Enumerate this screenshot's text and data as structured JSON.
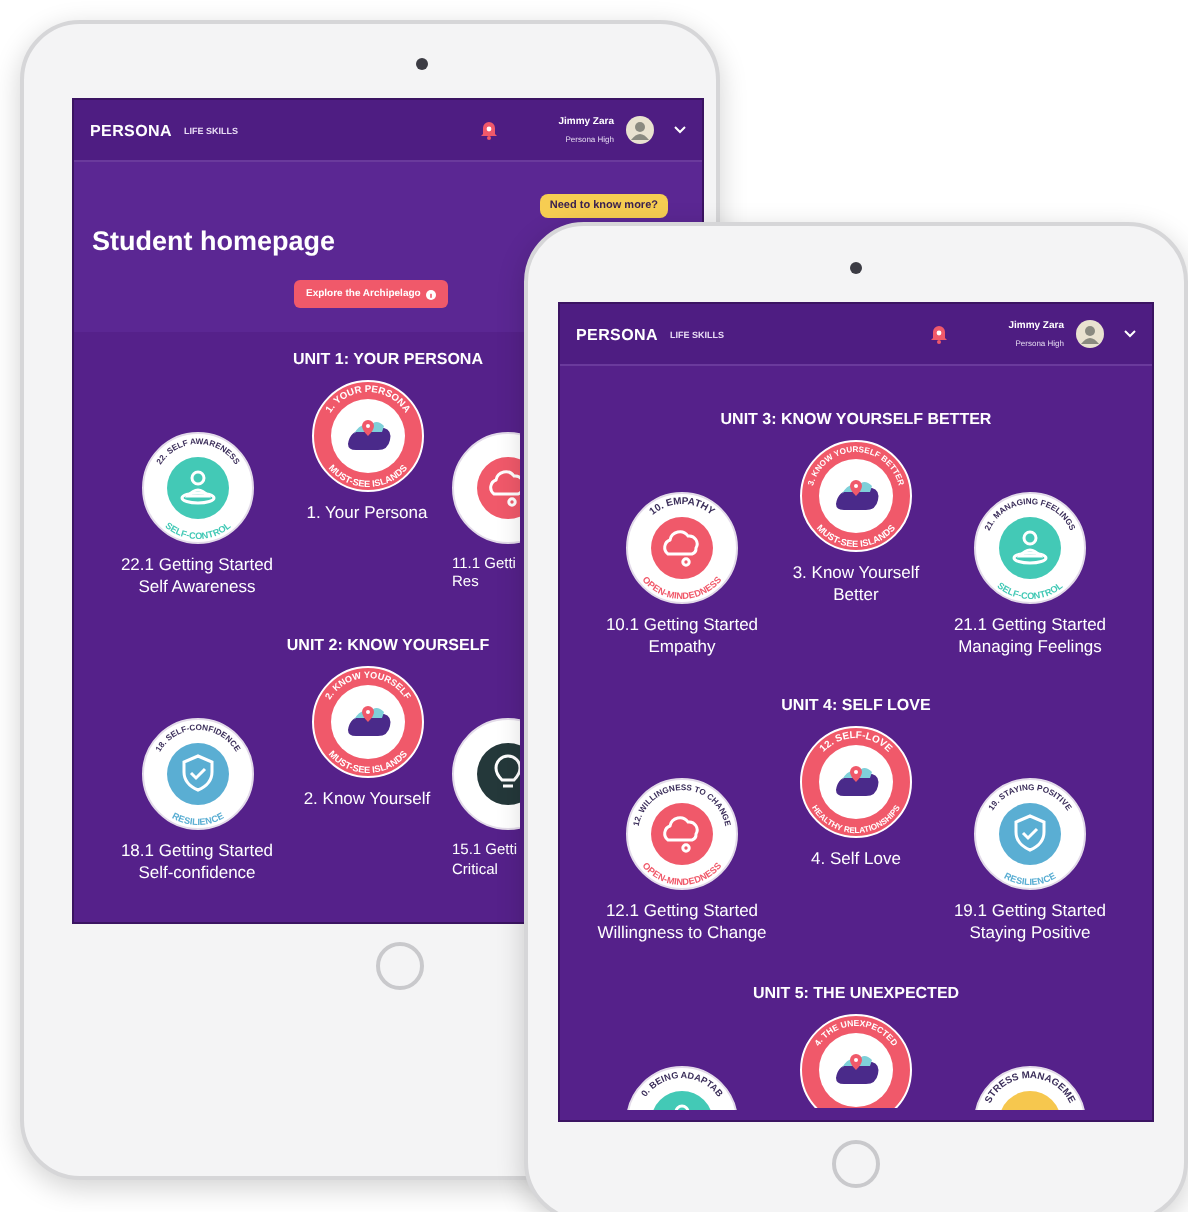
{
  "tablets": [
    {
      "header": {
        "logo": "PERSONA",
        "logo_suffix": "LIFE SKILLS",
        "user_name": "Jimmy Zara",
        "school": "Persona High"
      },
      "hero": {
        "help_button": "Need to know more?",
        "title": "Student homepage",
        "explore_button": "Explore the Archipelago"
      },
      "units": [
        {
          "title": "UNIT 1: YOUR PERSONA",
          "items": [
            {
              "kind": "control",
              "ring_top": "22. SELF AWARENESS",
              "ring_bottom": "SELF-CONTROL",
              "label": [
                "22.1 Getting Started",
                "Self Awareness"
              ]
            },
            {
              "kind": "island",
              "ring_top": "1. YOUR PERSONA",
              "ring_bottom": "MUST-SEE ISLANDS",
              "label": [
                "1. Your Persona"
              ]
            },
            {
              "kind": "open",
              "label": [
                "11.1 Getti",
                "Res"
              ]
            }
          ]
        },
        {
          "title": "UNIT 2: KNOW YOURSELF",
          "items": [
            {
              "kind": "resilience",
              "ring_top": "18. SELF-CONFIDENCE",
              "ring_bottom": "RESILIENCE",
              "label": [
                "18.1 Getting Started",
                "Self-confidence"
              ]
            },
            {
              "kind": "island",
              "ring_top": "2. KNOW YOURSELF",
              "ring_bottom": "MUST-SEE ISLANDS",
              "label": [
                "2. Know Yourself"
              ]
            },
            {
              "kind": "problem",
              "label": [
                "15.1 Getti",
                "Critical"
              ]
            }
          ]
        }
      ]
    },
    {
      "header": {
        "logo": "PERSONA",
        "logo_suffix": "LIFE SKILLS",
        "user_name": "Jimmy Zara",
        "school": "Persona High"
      },
      "units": [
        {
          "title": "UNIT 3: KNOW YOURSELF BETTER",
          "items": [
            {
              "kind": "open",
              "ring_top": "10. EMPATHY",
              "ring_bottom": "OPEN-MINDEDNESS",
              "label": [
                "10.1 Getting Started",
                "Empathy"
              ]
            },
            {
              "kind": "island",
              "ring_top": "3. KNOW YOURSELF BETTER",
              "ring_bottom": "MUST-SEE ISLANDS",
              "label": [
                "3. Know Yourself",
                "Better"
              ]
            },
            {
              "kind": "control",
              "ring_top": "21. MANAGING FEELINGS",
              "ring_bottom": "SELF-CONTROL",
              "label": [
                "21.1 Getting Started",
                "Managing Feelings"
              ]
            }
          ]
        },
        {
          "title": "UNIT 4: SELF LOVE",
          "items": [
            {
              "kind": "open",
              "ring_top": "12. WILLINGNESS TO CHANGE",
              "ring_bottom": "OPEN-MINDEDNESS",
              "label": [
                "12.1 Getting Started",
                "Willingness to Change"
              ]
            },
            {
              "kind": "island",
              "ring_top": "12. SELF-LOVE",
              "ring_bottom": "HEALTHY RELATIONSHIPS",
              "label": [
                "4. Self Love"
              ]
            },
            {
              "kind": "resilience",
              "ring_top": "19. STAYING POSITIVE",
              "ring_bottom": "RESILIENCE",
              "label": [
                "19.1 Getting Started",
                "Staying Positive"
              ]
            }
          ]
        },
        {
          "title": "UNIT 5: THE UNEXPECTED",
          "items": [
            {
              "kind": "control",
              "ring_top": "0. BEING ADAPTAB"
            },
            {
              "kind": "island",
              "ring_top": "4. THE UNEXPECTED"
            },
            {
              "kind": "stress",
              "ring_top": "STRESS MANAGEME"
            }
          ]
        }
      ]
    }
  ]
}
